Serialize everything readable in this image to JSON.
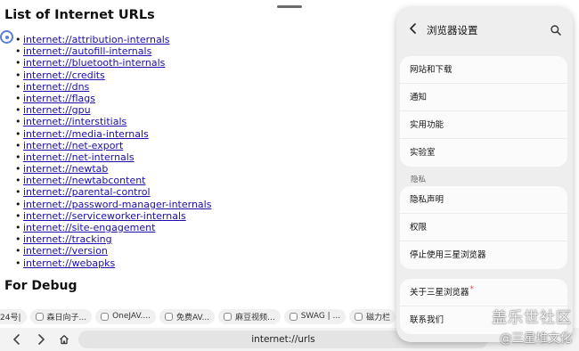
{
  "page": {
    "title": "List of Internet URLs",
    "urls": [
      "internet://attribution-internals",
      "internet://autofill-internals",
      "internet://bluetooth-internals",
      "internet://credits",
      "internet://dns",
      "internet://flags",
      "internet://gpu",
      "internet://interstitials",
      "internet://media-internals",
      "internet://net-export",
      "internet://net-internals",
      "internet://newtab",
      "internet://newtabcontent",
      "internet://parental-control",
      "internet://password-manager-internals",
      "internet://serviceworker-internals",
      "internet://site-engagement",
      "internet://tracking",
      "internet://version",
      "internet://webapks"
    ],
    "debug_title": "For Debug"
  },
  "bookmarks": [
    "24号|",
    "森日向子...",
    "OneJAV....",
    "免费AV...",
    "麻豆视频...",
    "SWAG | ...",
    "磁力栏"
  ],
  "toolbar": {
    "back_icon": "chevron-left-icon",
    "forward_icon": "chevron-right-icon",
    "home_icon": "home-icon",
    "address": "internet://urls"
  },
  "settings": {
    "title": "浏览器设置",
    "back_icon": "chevron-left-icon",
    "search_icon": "search-icon",
    "group1": [
      "网站和下载",
      "通知",
      "实用功能",
      "实验室"
    ],
    "privacy_label": "隐私",
    "group2": [
      "隐私声明",
      "权限",
      "停止使用三星浏览器"
    ],
    "group3": [
      "关于三星浏览器",
      "联系我们"
    ],
    "about_badge": "*"
  },
  "watermark": {
    "line1": "盖乐世社区",
    "line2": "@三星堆文化"
  },
  "colors": {
    "link": "#1a0dab",
    "panel_bg": "#eeeeee",
    "badge": "#e0443c"
  }
}
